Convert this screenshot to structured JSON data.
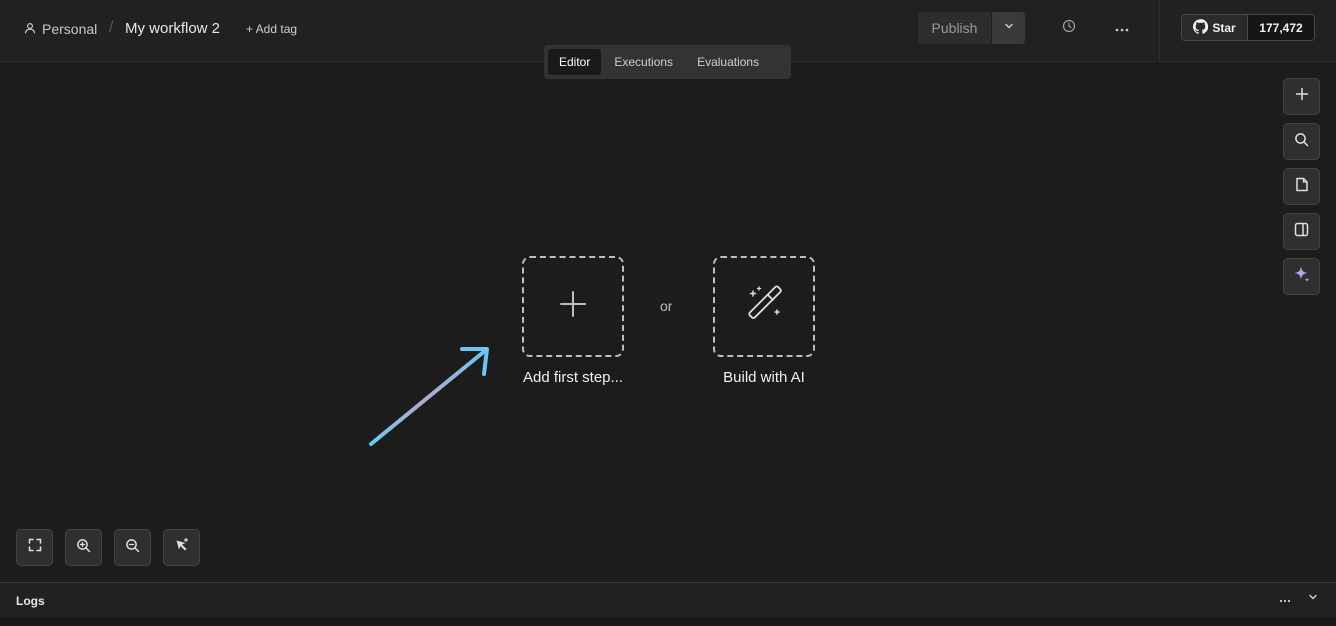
{
  "header": {
    "project": "Personal",
    "separator": "/",
    "workflow_name": "My workflow 2",
    "add_tag": "+ Add tag",
    "publish_label": "Publish",
    "github_star_label": "Star",
    "github_star_count": "177,472"
  },
  "tabs": [
    {
      "label": "Editor",
      "active": true
    },
    {
      "label": "Executions",
      "active": false
    },
    {
      "label": "Evaluations",
      "active": false
    }
  ],
  "canvas": {
    "add_first_step_label": "Add first step...",
    "or_label": "or",
    "build_with_ai_label": "Build with AI"
  },
  "right_toolbar": [
    {
      "icon": "plus-icon"
    },
    {
      "icon": "search-icon"
    },
    {
      "icon": "sticky-note-icon"
    },
    {
      "icon": "panel-icon"
    },
    {
      "icon": "sparkle-icon"
    }
  ],
  "zoom_controls": [
    {
      "icon": "fit-view-icon"
    },
    {
      "icon": "zoom-in-icon"
    },
    {
      "icon": "zoom-out-icon"
    },
    {
      "icon": "tidy-up-icon"
    }
  ],
  "logs": {
    "title": "Logs"
  },
  "colors": {
    "background": "#1b1b1b",
    "header": "#212121",
    "arrow_start": "#9a8fd6",
    "arrow_end": "#6cc6f0",
    "ai_accent": "#b9a6e8"
  }
}
